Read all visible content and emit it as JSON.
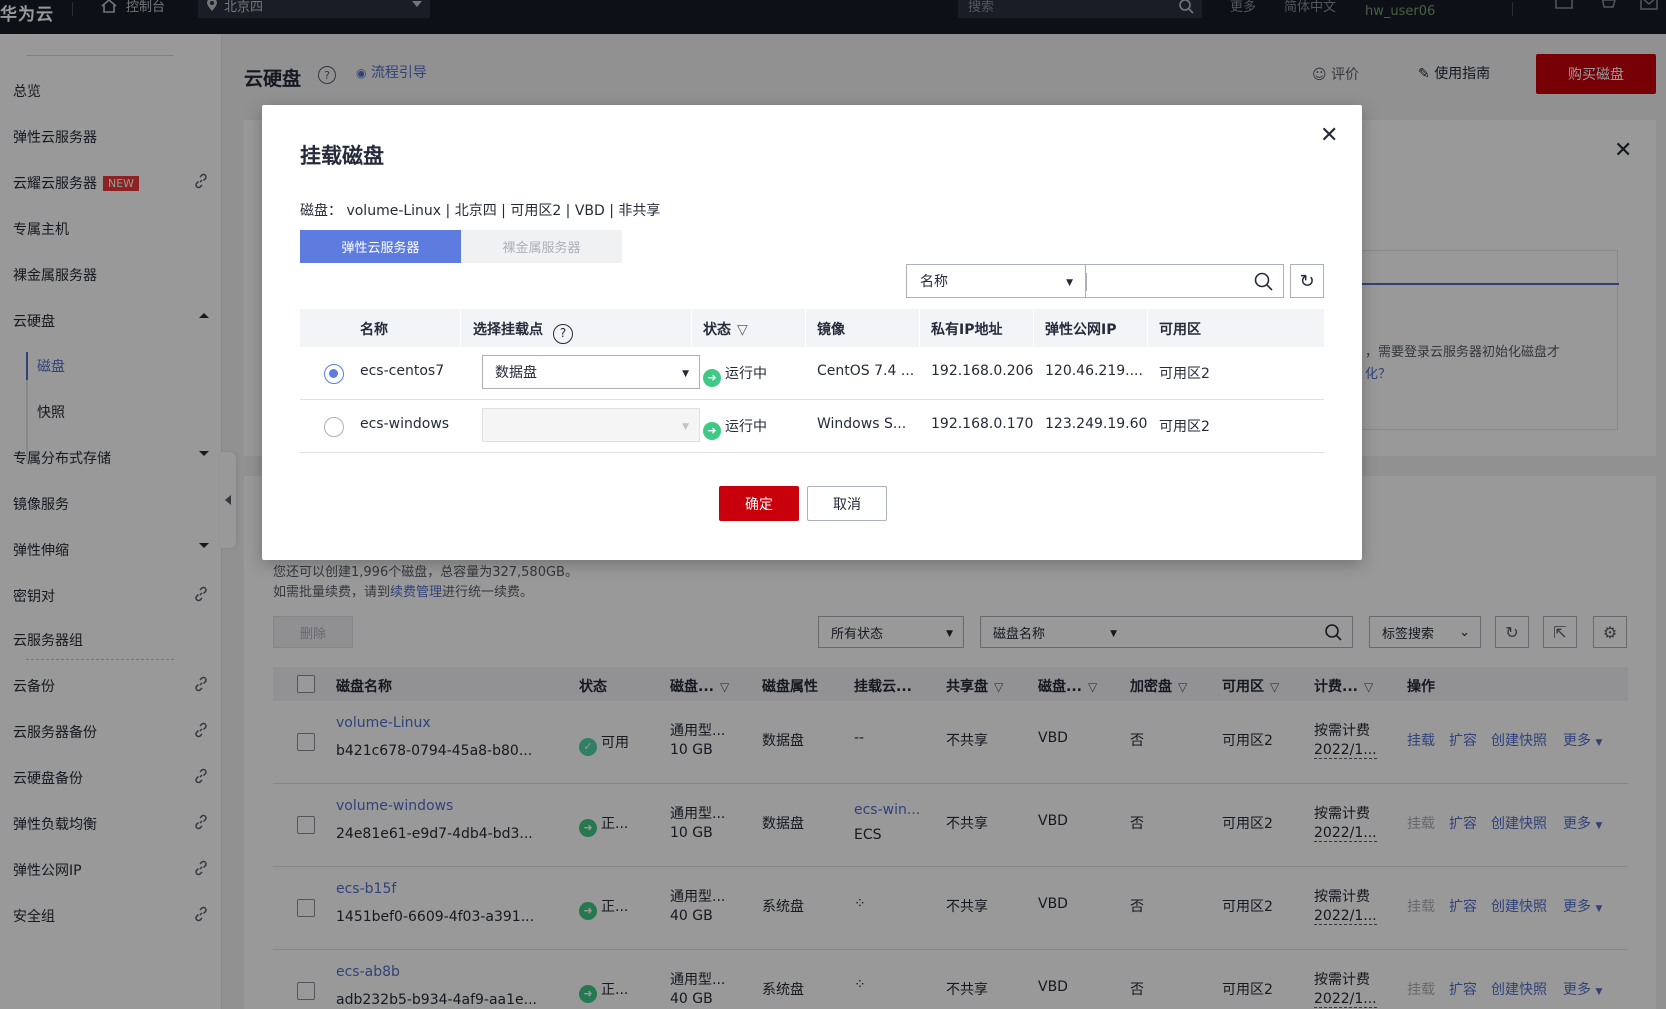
{
  "topbar": {
    "logo": "华为云",
    "console": "控制台",
    "region": "北京四",
    "search_placeholder": "搜索",
    "more": "更多",
    "language": "简体中文",
    "user": "hw_user06"
  },
  "sidebar": {
    "items": [
      {
        "label": "总览"
      },
      {
        "label": "弹性云服务器"
      },
      {
        "label": "云耀云服务器",
        "badge": "NEW"
      },
      {
        "label": "专属主机"
      },
      {
        "label": "裸金属服务器"
      },
      {
        "label": "云硬盘"
      },
      {
        "label": "专属分布式存储"
      },
      {
        "label": "镜像服务"
      },
      {
        "label": "弹性伸缩"
      },
      {
        "label": "密钥对"
      },
      {
        "label": "云服务器组"
      },
      {
        "label": "云备份"
      },
      {
        "label": "云服务器备份"
      },
      {
        "label": "云硬盘备份"
      },
      {
        "label": "弹性负载均衡"
      },
      {
        "label": "弹性公网IP"
      },
      {
        "label": "安全组"
      }
    ],
    "sub_items": [
      {
        "label": "磁盘"
      },
      {
        "label": "快照"
      }
    ]
  },
  "page": {
    "title": "云硬盘",
    "flow_guide": "流程引导",
    "rate": "评价",
    "guide": "使用指南",
    "buy_button": "购买磁盘",
    "panel_hint": "，需要登录云服务器初始化磁盘才",
    "panel_hint_link": "化？",
    "quota_text": "您还可以创建1,996个磁盘，总容量为327,580GB。",
    "renew_prefix": "如需批量续费，请到",
    "renew_link": "续费管理",
    "renew_suffix": "进行统一续费。",
    "delete_button": "删除",
    "status_filter": "所有状态",
    "name_filter": "磁盘名称",
    "tag_search": "标签搜索"
  },
  "disk_table": {
    "headers": [
      "磁盘名称",
      "状态",
      "磁盘...",
      "磁盘属性",
      "挂载云...",
      "共享盘",
      "磁盘...",
      "加密盘",
      "可用区",
      "计费...",
      "操作"
    ],
    "rows": [
      {
        "name": "volume-Linux",
        "id": "b421c678-0794-45a8-b80...",
        "status": "可用",
        "type": "通用型...",
        "size": "10 GB",
        "attr": "数据盘",
        "server": "--",
        "server2": "",
        "share": "不共享",
        "mode": "VBD",
        "encrypt": "否",
        "zone": "可用区2",
        "billing": "按需计费",
        "billing_date": "2022/1...",
        "op_attach": "挂载"
      },
      {
        "name": "volume-windows",
        "id": "24e81e61-e9d7-4db4-bd3...",
        "status": "正...",
        "type": "通用型...",
        "size": "10 GB",
        "attr": "数据盘",
        "server": "ecs-win...",
        "server2": "ECS",
        "share": "不共享",
        "mode": "VBD",
        "encrypt": "否",
        "zone": "可用区2",
        "billing": "按需计费",
        "billing_date": "2022/1...",
        "op_attach": "挂载"
      },
      {
        "name": "ecs-b15f",
        "id": "1451bef0-6609-4f03-a391...",
        "status": "正...",
        "type": "通用型...",
        "size": "40 GB",
        "attr": "系统盘",
        "server": "",
        "server2": "",
        "share": "不共享",
        "mode": "VBD",
        "encrypt": "否",
        "zone": "可用区2",
        "billing": "按需计费",
        "billing_date": "2022/1...",
        "op_attach": "挂载"
      },
      {
        "name": "ecs-ab8b",
        "id": "adb232b5-b934-4af9-aa1e...",
        "status": "正...",
        "type": "通用型...",
        "size": "40 GB",
        "attr": "系统盘",
        "server": "",
        "server2": "",
        "share": "不共享",
        "mode": "VBD",
        "encrypt": "否",
        "zone": "可用区2",
        "billing": "按需计费",
        "billing_date": "2022/1...",
        "op_attach": "挂载"
      }
    ],
    "op_expand": "扩容",
    "op_snapshot": "创建快照",
    "op_more": "更多"
  },
  "dialog": {
    "title": "挂载磁盘",
    "info": "磁盘： volume-Linux  | 北京四 | 可用区2 | VBD | 非共享",
    "tab_active": "弹性云服务器",
    "tab_inactive": "裸金属服务器",
    "search_field": "名称",
    "headers": [
      "名称",
      "选择挂载点",
      "状态",
      "镜像",
      "私有IP地址",
      "弹性公网IP",
      "可用区"
    ],
    "rows": [
      {
        "selected": true,
        "name": "ecs-centos7",
        "mount": "数据盘",
        "status": "运行中",
        "image": "CentOS 7.4 ...",
        "private_ip": "192.168.0.206",
        "eip": "120.46.219....",
        "zone": "可用区2"
      },
      {
        "selected": false,
        "name": "ecs-windows",
        "mount": "",
        "status": "运行中",
        "image": "Windows S...",
        "private_ip": "192.168.0.170",
        "eip": "123.249.19.60",
        "zone": "可用区2"
      }
    ],
    "confirm": "确定",
    "cancel": "取消"
  },
  "colors": {
    "brand_red": "#c7000b",
    "link_blue": "#526ecc",
    "tab_blue": "#5e7ce0",
    "status_green": "#3fc985"
  }
}
